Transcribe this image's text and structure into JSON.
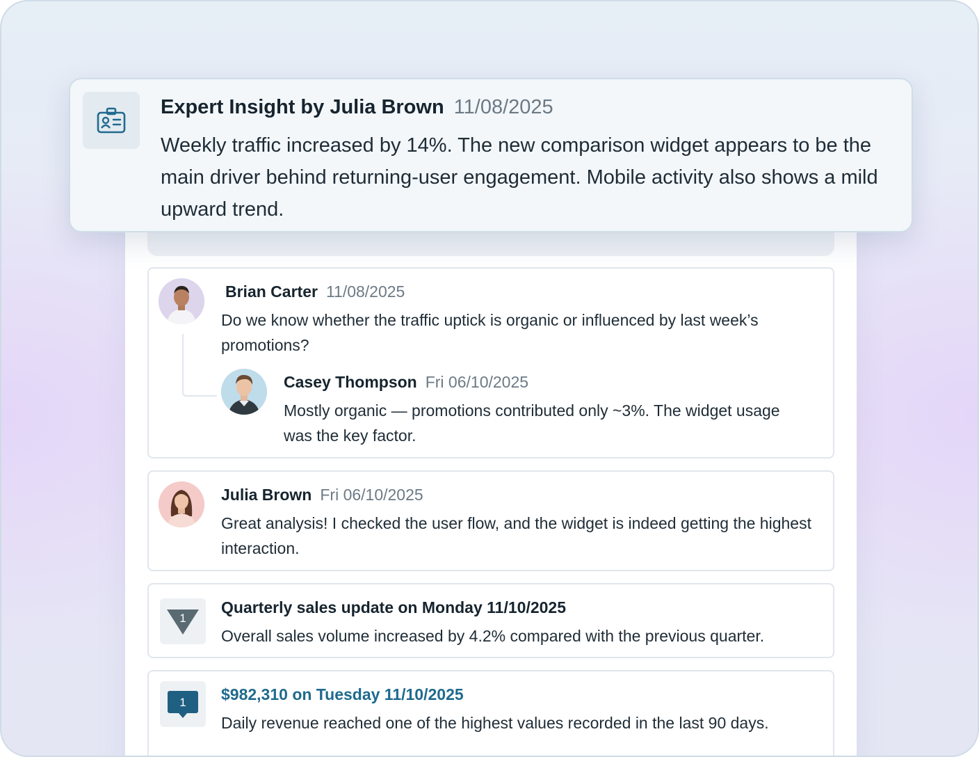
{
  "insight": {
    "title": "Expert Insight by Julia Brown",
    "date": "11/08/2025",
    "body": "Weekly traffic increased by 14%. The new comparison widget appears to be the main driver behind returning-user engagement. Mobile activity also shows a mild upward trend.",
    "icon": "id-badge-icon"
  },
  "comments": [
    {
      "name": "Brian Carter",
      "date": "11/08/2025",
      "text": "Do we know whether the traffic uptick is organic or influenced by last week’s promotions?",
      "reply": {
        "name": "Casey Thompson",
        "date": "Fri 06/10/2025",
        "text": "Mostly organic — promotions contributed only ~3%. The widget usage was the key factor."
      }
    },
    {
      "name": "Julia Brown",
      "date": "Fri 06/10/2025",
      "text": "Great analysis! I checked the user flow, and the widget is indeed getting the highest interaction."
    }
  ],
  "events": [
    {
      "badge": "1",
      "icon": "triangle-marker-icon",
      "title": "Quarterly sales update on Monday 11/10/2025",
      "text": "Overall sales volume increased by 4.2% compared with the previous quarter."
    },
    {
      "badge": "1",
      "icon": "speech-marker-icon",
      "title": "$982,310 on Tuesday 11/10/2025",
      "text": "Daily revenue reached one of the highest values recorded in the last 90 days.",
      "accent": "#1f6a8e"
    }
  ],
  "colors": {
    "accent": "#1f6a8e",
    "triangle": "#5a6a73"
  }
}
